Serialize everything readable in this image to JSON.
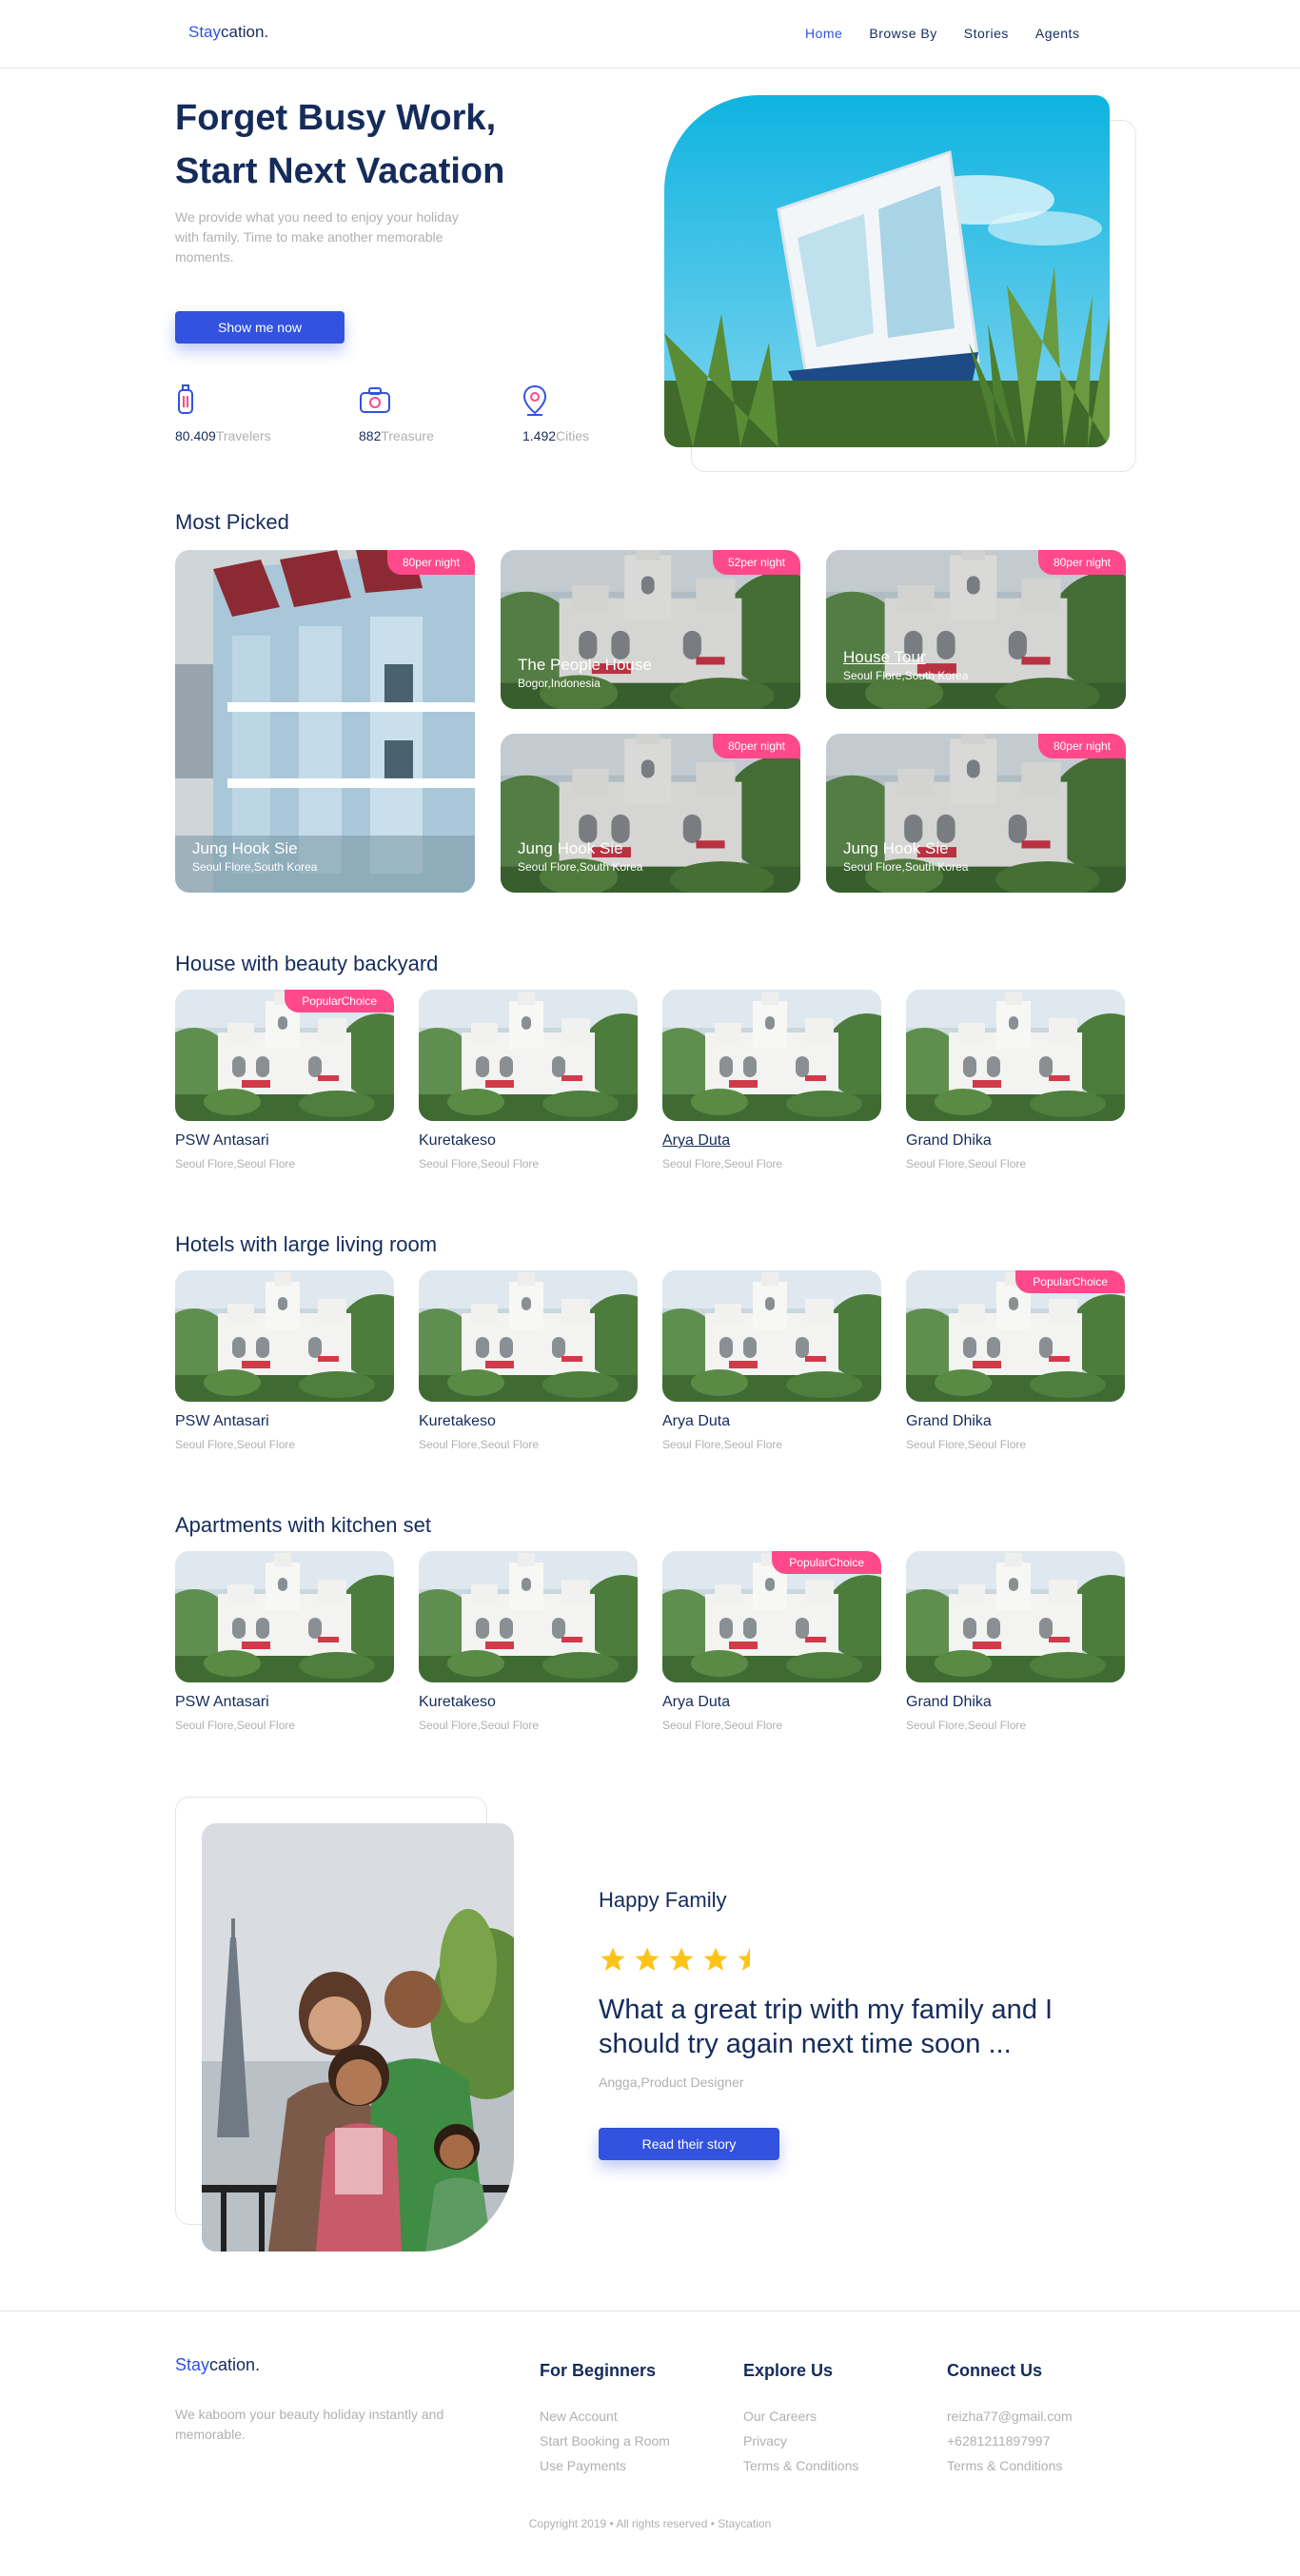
{
  "header": {
    "logo_accent": "Stay",
    "logo_rest": "cation.",
    "nav": [
      "Home",
      "Browse By",
      "Stories",
      "Agents"
    ]
  },
  "hero": {
    "title": "Forget Busy Work, Start Next Vacation",
    "description": "We provide what you need to enjoy your holiday with family. Time to make another memorable moments.",
    "button": "Show me now",
    "stats": [
      {
        "value": "80.409",
        "label": "Travelers",
        "icon": "suitcase-icon"
      },
      {
        "value": "882",
        "label": "Treasure",
        "icon": "camera-icon"
      },
      {
        "value": "1.492",
        "label": "Cities",
        "icon": "map-pin-icon"
      }
    ]
  },
  "most_picked": {
    "title": "Most Picked",
    "items": [
      {
        "badge": "80per night",
        "name": "Jung Hook Sie",
        "location": "Seoul Flore,South Korea"
      },
      {
        "badge": "52per night",
        "name": "The People House",
        "location": "Bogor,Indonesia"
      },
      {
        "badge": "80per night",
        "name": "House Tour",
        "location": "Seoul Flore,South Korea"
      },
      {
        "badge": "80per night",
        "name": "Jung Hook Sie",
        "location": "Seoul Flore,South Korea"
      },
      {
        "badge": "80per night",
        "name": "Jung Hook Sie",
        "location": "Seoul Flore,South Korea"
      }
    ]
  },
  "categories": [
    {
      "title": "House with beauty backyard",
      "items": [
        {
          "name": "PSW Antasari",
          "location": "Seoul Flore,Seoul Flore",
          "badge": "PopularChoice"
        },
        {
          "name": "Kuretakeso",
          "location": "Seoul Flore,Seoul Flore",
          "badge": ""
        },
        {
          "name": "Arya Duta",
          "location": "Seoul Flore,Seoul Flore",
          "badge": ""
        },
        {
          "name": "Grand Dhika",
          "location": "Seoul Flore,Seoul Flore",
          "badge": ""
        }
      ]
    },
    {
      "title": "Hotels with large living room",
      "items": [
        {
          "name": "PSW Antasari",
          "location": "Seoul Flore,Seoul Flore",
          "badge": ""
        },
        {
          "name": "Kuretakeso",
          "location": "Seoul Flore,Seoul Flore",
          "badge": ""
        },
        {
          "name": "Arya Duta",
          "location": "Seoul Flore,Seoul Flore",
          "badge": ""
        },
        {
          "name": "Grand Dhika",
          "location": "Seoul Flore,Seoul Flore",
          "badge": "PopularChoice"
        }
      ]
    },
    {
      "title": "Apartments with kitchen set",
      "items": [
        {
          "name": "PSW Antasari",
          "location": "Seoul Flore,Seoul Flore",
          "badge": ""
        },
        {
          "name": "Kuretakeso",
          "location": "Seoul Flore,Seoul Flore",
          "badge": ""
        },
        {
          "name": "Arya Duta",
          "location": "Seoul Flore,Seoul Flore",
          "badge": "PopularChoice"
        },
        {
          "name": "Grand Dhika",
          "location": "Seoul Flore,Seoul Flore",
          "badge": ""
        }
      ]
    }
  ],
  "testimonial": {
    "label": "Happy Family",
    "rating": 4.5,
    "quote": "What a great trip with my family and I should try again next time soon ...",
    "author": "Angga,Product Designer",
    "button": "Read their story"
  },
  "footer": {
    "logo_accent": "Stay",
    "logo_rest": "cation.",
    "description": "We kaboom your beauty holiday instantly and memorable.",
    "columns": [
      {
        "title": "For Beginners",
        "links": [
          "New Account",
          "Start Booking a Room",
          "Use Payments"
        ]
      },
      {
        "title": "Explore Us",
        "links": [
          "Our Careers",
          "Privacy",
          "Terms & Conditions"
        ]
      },
      {
        "title": "Connect Us",
        "links": [
          "reizha77@gmail.com",
          "+6281211897997",
          "Terms & Conditions"
        ]
      }
    ],
    "copyright": "Copyright 2019 • All rights reserved • Staycation"
  },
  "colors": {
    "primary": "#3252df",
    "dark": "#152c5b",
    "muted": "#b0b0b0",
    "badge": "#ff498b",
    "star": "#fcc419"
  }
}
